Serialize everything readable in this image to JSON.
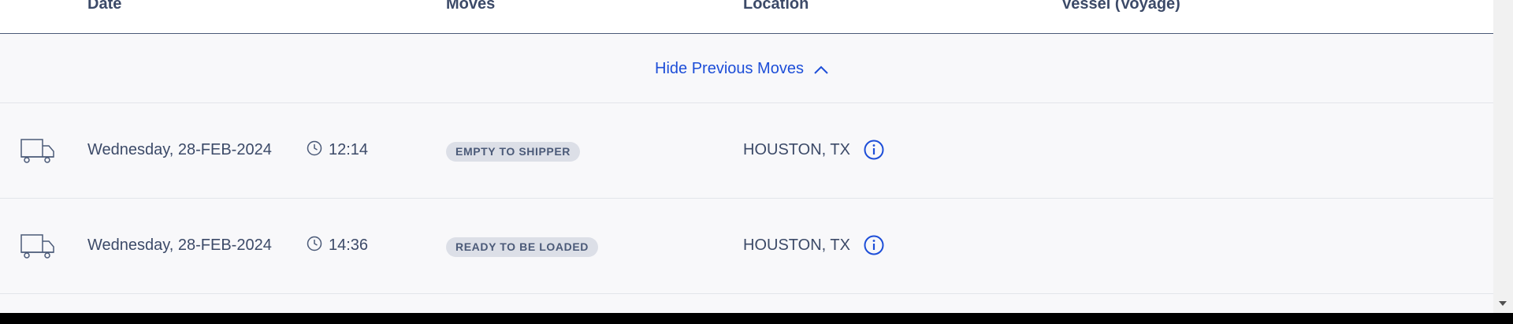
{
  "table": {
    "headers": [
      "Date",
      "Moves",
      "Location",
      "Vessel (Voyage)"
    ],
    "hide_previous_label": "Hide Previous Moves",
    "rows": [
      {
        "date": "Wednesday, 28-FEB-2024",
        "time": "12:14",
        "move": "EMPTY TO SHIPPER",
        "location": "HOUSTON, TX",
        "vessel": ""
      },
      {
        "date": "Wednesday, 28-FEB-2024",
        "time": "14:36",
        "move": "READY TO BE LOADED",
        "location": "HOUSTON, TX",
        "vessel": ""
      }
    ]
  },
  "icons": {
    "row_type": "truck-icon",
    "time": "clock-icon",
    "detail": "info-icon",
    "toggle": "chevron-up-icon",
    "scroll": "scroll-down-arrow-icon"
  },
  "colors": {
    "link": "#1d4ed8",
    "text": "#3c4a68",
    "badge_bg": "#dcdfe7",
    "row_bg": "#f8f8fa",
    "header_border": "#4b5a78"
  }
}
